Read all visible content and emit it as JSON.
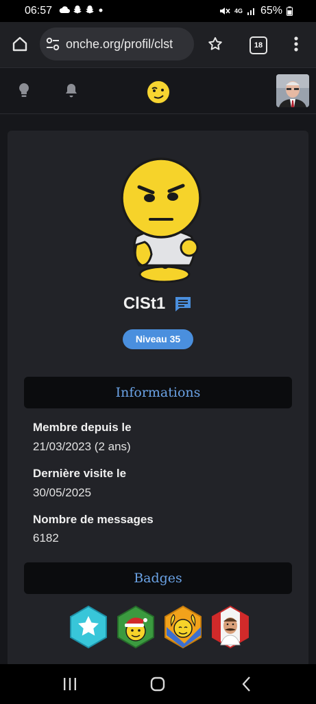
{
  "status_bar": {
    "time": "06:57",
    "left_icons": [
      "cloud-icon",
      "snapchat-icon",
      "snapchat-icon",
      "dot-icon"
    ],
    "right_icons": [
      "mute-icon",
      "4g-icon",
      "signal-icon"
    ],
    "network_label": "4G",
    "battery": "65%"
  },
  "browser": {
    "url": "onche.org/profil/clst",
    "tab_count": "18"
  },
  "profile": {
    "username": "ClSt1",
    "level_label": "Niveau 35"
  },
  "sections": {
    "informations_title": "Informations",
    "badges_title": "Badges"
  },
  "info": {
    "member_since_label": "Membre depuis le",
    "member_since_value": "21/03/2023 (2 ans)",
    "last_visit_label": "Dernière visite le",
    "last_visit_value": "30/05/2025",
    "messages_label": "Nombre de messages",
    "messages_value": "6182"
  },
  "badges": [
    "star-hexagon-badge",
    "christmas-hat-smiley-badge",
    "raised-hands-smiley-badge",
    "chef-portrait-badge"
  ],
  "colors": {
    "accent": "#4a8fde",
    "section_title": "#6ba3e6",
    "card_bg": "#222328",
    "page_bg": "#16171b"
  }
}
